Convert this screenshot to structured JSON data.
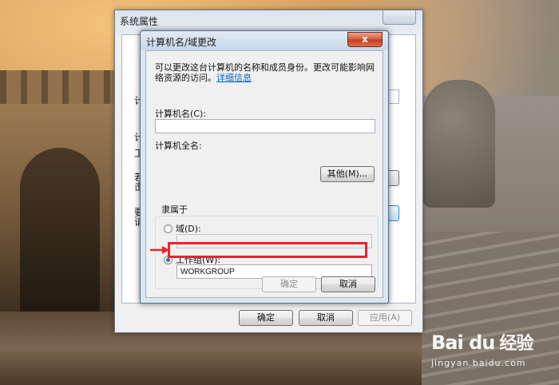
{
  "background": {
    "watermark_logo": "Bai du",
    "watermark_cn": "经验",
    "watermark_url": "jingyan.baidu.com"
  },
  "system_properties": {
    "title": "系统属性",
    "tab_partial": "计",
    "peek_labels": [
      "计",
      "计",
      "工",
      "若",
      "击",
      "要",
      "请"
    ],
    "buttons": {
      "ok": "确定",
      "cancel": "取消",
      "apply": "应用(A)"
    }
  },
  "dialog": {
    "title": "计算机名/域更改",
    "close_label": "x",
    "description": "可以更改这台计算机的名称和成员身份。更改可能影响网络资源的访问。",
    "details_link": "详细信息",
    "computer_name_label": "计算机名(C):",
    "computer_name_value": "",
    "full_name_label": "计算机全名:",
    "full_name_value": "",
    "more_button": "其他(M)...",
    "member_of": {
      "legend": "隶属于",
      "domain_label": "域(D):",
      "domain_value": "",
      "domain_selected": false,
      "workgroup_label": "工作组(W):",
      "workgroup_value": "WORKGROUP",
      "workgroup_selected": true
    },
    "ok_button": "确定",
    "cancel_button": "取消"
  },
  "annotation": {
    "highlight_color": "#e8242a"
  }
}
